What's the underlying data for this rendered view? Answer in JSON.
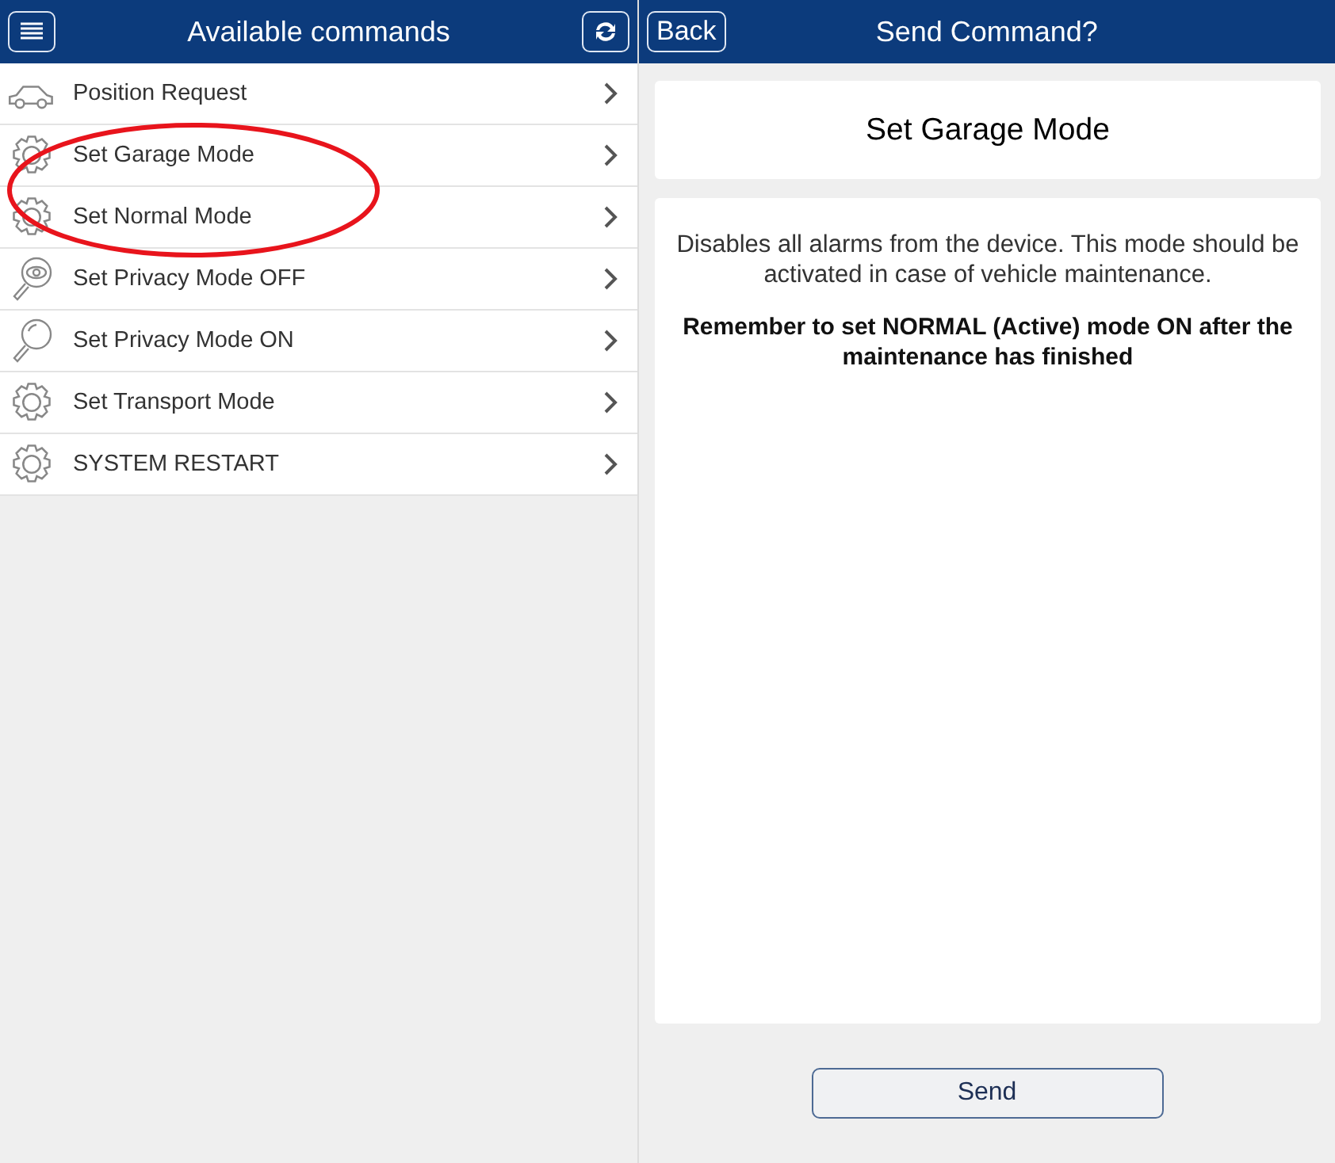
{
  "left_header": {
    "title": "Available commands"
  },
  "commands": [
    {
      "kind": "vehicle",
      "label": "Position Request"
    },
    {
      "kind": "gear",
      "label": "Set Garage Mode"
    },
    {
      "kind": "gear",
      "label": "Set Normal Mode"
    },
    {
      "kind": "eye_search",
      "label": "Set Privacy Mode OFF"
    },
    {
      "kind": "search",
      "label": "Set Privacy Mode ON"
    },
    {
      "kind": "gear",
      "label": "Set Transport Mode"
    },
    {
      "kind": "gear",
      "label": "SYSTEM RESTART"
    }
  ],
  "right_header": {
    "back": "Back",
    "title": "Send Command?"
  },
  "detail": {
    "title": "Set Garage Mode",
    "description": "Disables all alarms from the device. This mode should be activated in case of vehicle maintenance.",
    "warning": "Remember to set NORMAL (Active) mode ON after the maintenance has finished"
  },
  "send_button": "Send"
}
